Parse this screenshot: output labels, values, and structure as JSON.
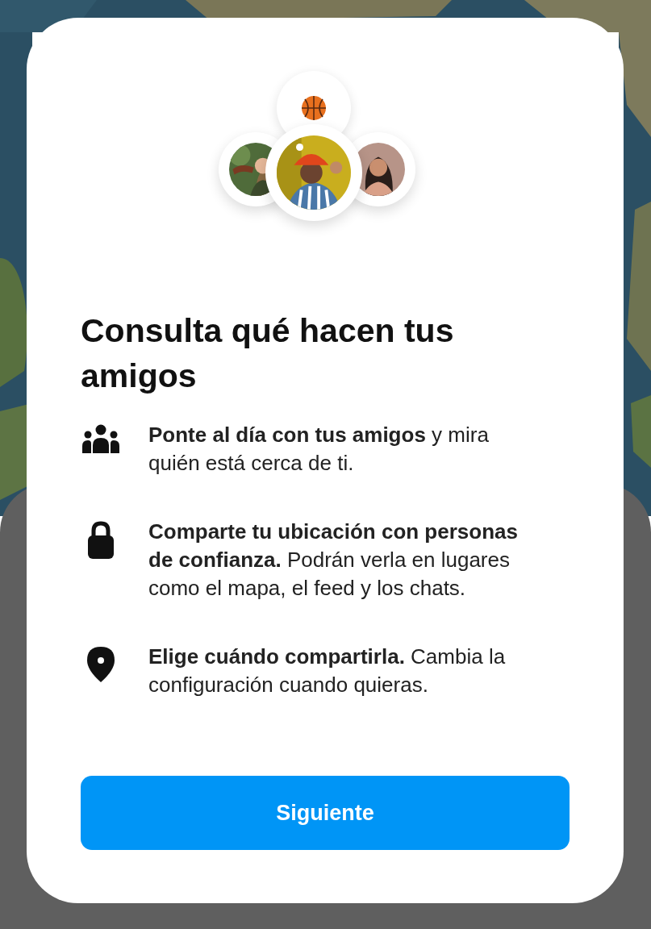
{
  "heading": "Consulta qué hacen tus amigos",
  "features": [
    {
      "text": "**Ponte al día con tus amigos** y mira quién está cerca de ti."
    },
    {
      "text": "**Comparte tu ubicación con personas de confianza.** Podrán verla en lugares como el mapa, el feed y los chats."
    },
    {
      "text": "**Elige cuándo compartirla.** Cambia la configuración cuando quieras."
    }
  ],
  "button": {
    "label": "Siguiente"
  }
}
